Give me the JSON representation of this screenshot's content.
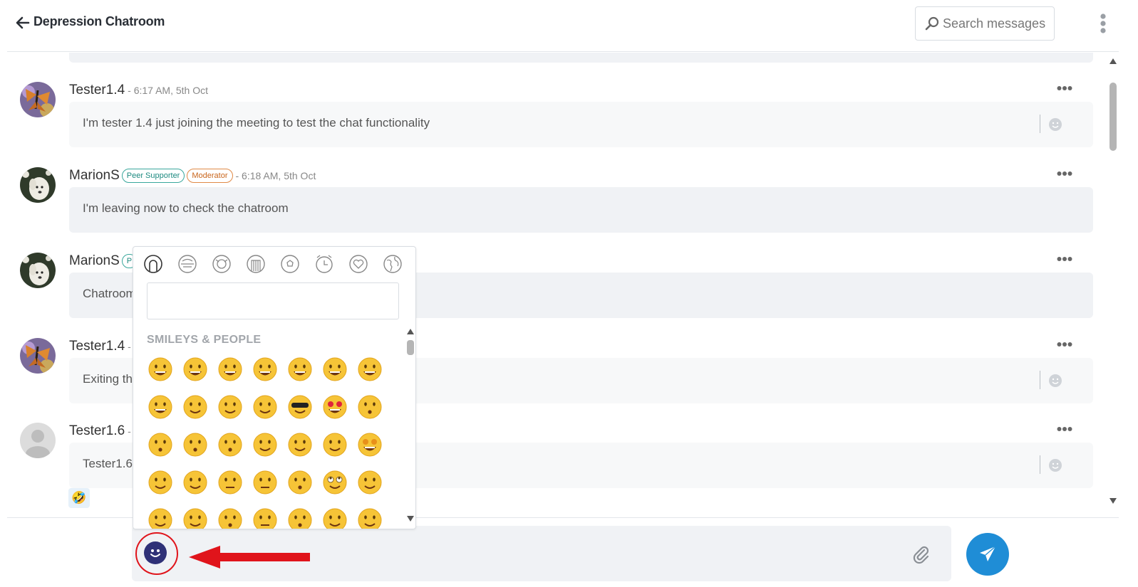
{
  "header": {
    "title": "Depression Chatroom",
    "search_placeholder": "Search messages"
  },
  "messages": [
    {
      "author": "Tester1.4",
      "timestamp": "- 6:17 AM, 5th Oct",
      "text": "I'm tester 1.4 just joining the meeting to test the chat functionality",
      "badges": [],
      "avatar": "butterfly-photo"
    },
    {
      "author": "MarionS",
      "timestamp": "- 6:18 AM, 5th Oct",
      "text": "I'm leaving now to check the chatroom",
      "badges": [
        "Peer Supporter",
        "Moderator"
      ],
      "avatar": "dog-photo"
    },
    {
      "author": "MarionS",
      "badge_partial": "P",
      "text": "Chatroom",
      "avatar": "dog-photo"
    },
    {
      "author": "Tester1.4",
      "timestamp": "-",
      "text": "Exiting th",
      "avatar": "butterfly-photo"
    },
    {
      "author": "Tester1.6",
      "timestamp": "-",
      "text": "Tester1.6",
      "avatar": "default-user"
    }
  ],
  "reaction": {
    "emoji": "🤣"
  },
  "emoji_picker": {
    "categories": [
      "smileys-people",
      "animals-nature",
      "food-drink",
      "travel-places",
      "activities",
      "objects",
      "symbols",
      "flags"
    ],
    "search_value": "",
    "section_title": "SMILEYS & PEOPLE",
    "emojis": [
      [
        "grinning",
        "beaming",
        "tears-of-joy",
        "rolling-laughing",
        "smiley",
        "grin",
        "sweat-smile"
      ],
      [
        "laughing",
        "wink",
        "blush",
        "yum",
        "sunglasses",
        "heart-eyes",
        "kissing-heart"
      ],
      [
        "kissing",
        "kissing-smiling-eyes",
        "kissing-closed-eyes",
        "relaxed",
        "slight-smile",
        "hugging",
        "star-struck"
      ],
      [
        "thinking",
        "raised-eyebrow",
        "neutral",
        "expressionless",
        "no-mouth",
        "rolling-eyes",
        "smirk"
      ],
      [
        "persevere",
        "disappointed-relieved",
        "open-mouth",
        "zipper-mouth",
        "hushed",
        "sleepy",
        "tired"
      ]
    ]
  },
  "composer": {
    "message_value": ""
  },
  "colors": {
    "accent": "#1f8dd6",
    "emoji_button": "#2f3177",
    "annotation_red": "#e0141b",
    "peer_badge": "#1d8a80",
    "moderator_badge": "#c9651b"
  }
}
